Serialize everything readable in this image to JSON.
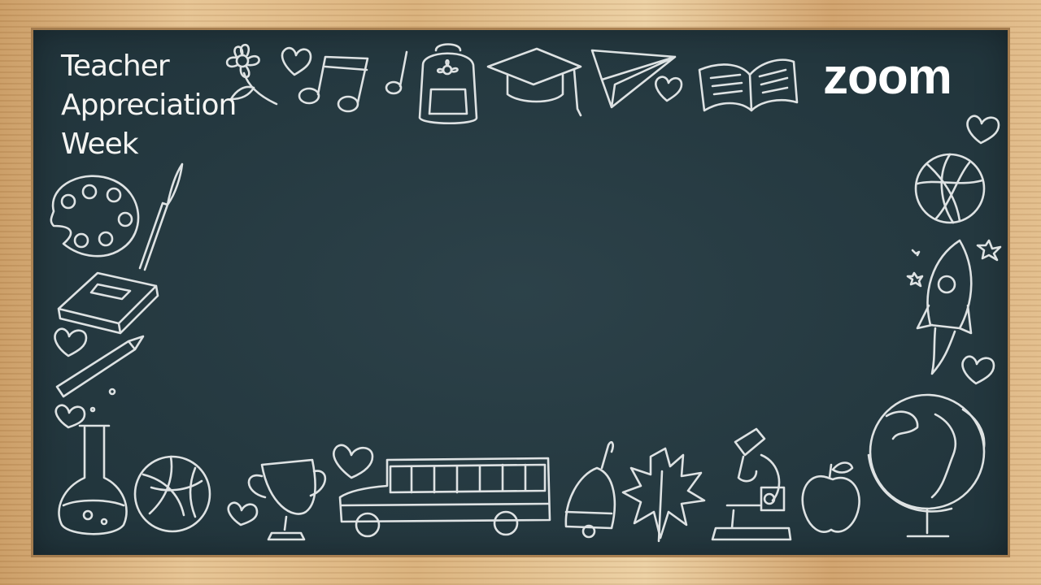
{
  "background": {
    "board_color": "#243a42",
    "frame_color": "#d8b585",
    "chalk_color": "#eef1f1"
  },
  "title": {
    "line1": "Teacher",
    "line2": "Appreciation",
    "line3": "Week"
  },
  "logo": {
    "text": "zoom"
  },
  "doodles": [
    "flower-icon",
    "heart-icon",
    "music-notes-icon",
    "backpack-icon",
    "graduation-cap-icon",
    "paper-plane-icon",
    "book-open-icon",
    "palette-icon",
    "paintbrush-icon",
    "closed-book-icon",
    "pencil-icon",
    "flask-icon",
    "volleyball-icon",
    "trophy-icon",
    "school-bus-icon",
    "bell-icon",
    "maple-leaf-icon",
    "microscope-icon",
    "apple-icon",
    "globe-icon",
    "rocket-icon",
    "basketball-icon",
    "star-icon"
  ]
}
